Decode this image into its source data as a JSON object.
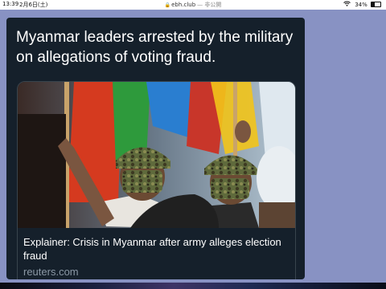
{
  "status_bar": {
    "time": "13:39",
    "date": "2月6日(土)",
    "url": "ebh.club",
    "url_suffix": "— 非公開",
    "battery": "34%",
    "battery_level": 0.34,
    "wifi_icon": "wifi-icon",
    "lock_icon": "lock-icon"
  },
  "tweet": {
    "text": "Myanmar leaders arrested by the military on allegations of voting fraud.",
    "link_card": {
      "title": "Explainer: Crisis in Myanmar after army alleges election fraud",
      "domain": "reuters.com",
      "image": "news-photo"
    }
  },
  "colors": {
    "background": "#8892c3",
    "card": "#15202b",
    "text": "#ffffff",
    "muted": "#8b98a5"
  }
}
